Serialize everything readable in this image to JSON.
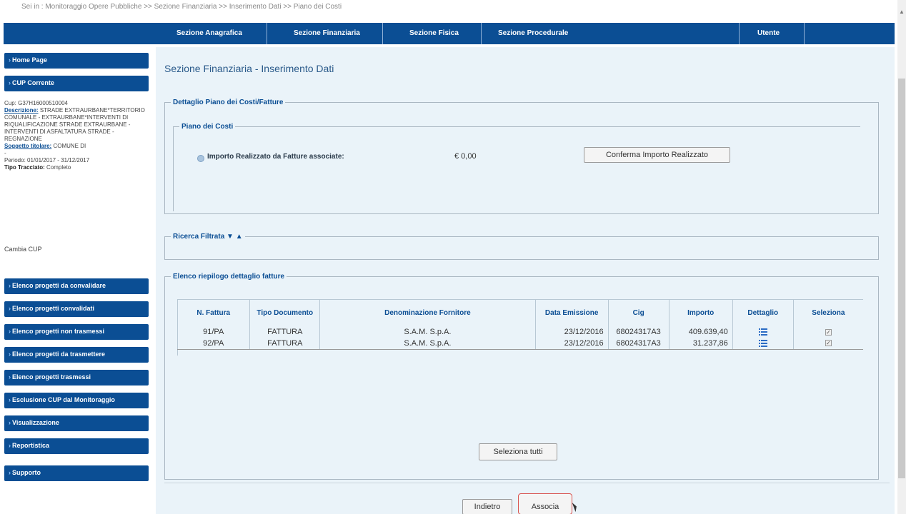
{
  "breadcrumb": "Sei in : Monitoraggio Opere Pubbliche >> Sezione Finanziaria >> Inserimento Dati >> Piano dei Costi",
  "topnav": {
    "items": [
      "Sezione Anagrafica",
      "Sezione Finanziaria",
      "Sezione Fisica",
      "Sezione Procedurale"
    ],
    "user": "Utente"
  },
  "sidebar": {
    "home": "Home Page",
    "cup_corrente": "CUP Corrente",
    "cup_info": {
      "cup_line": "Cup: G37H16000510004",
      "descrizione_label": "Descrizione:",
      "descrizione_value": "STRADE EXTRAURBANE*TERRITORIO COMUNALE - EXTRAURBANE*INTERVENTI DI RIQUALIFICAZIONE STRADE EXTRAURBANE - INTERVENTI DI ASFALTATURA STRADE - REGNAZIONE",
      "soggetto_label": "Soggetto titolare:",
      "soggetto_value": "COMUNE DI",
      "dash": "-",
      "periodo": "Periodo: 01/01/2017 - 31/12/2017",
      "tipo_label": "Tipo Tracciato:",
      "tipo_value": "Completo"
    },
    "cambia_cup": "Cambia CUP",
    "menu": [
      "Elenco progetti da convalidare",
      "Elenco progetti convalidati",
      "Elenco progetti non trasmessi",
      "Elenco progetti da trasmettere",
      "Elenco progetti trasmessi",
      "Esclusione CUP dal Monitoraggio",
      "Visualizzazione",
      "Reportistica",
      "Supporto"
    ]
  },
  "page": {
    "title": "Sezione Finanziaria - Inserimento Dati",
    "dettaglio_legend": "Dettaglio Piano dei Costi/Fatture",
    "piano_legend": "Piano dei Costi",
    "importo_label": "Importo Realizzato da Fatture associate:",
    "importo_value": "€ 0,00",
    "conferma_button": "Conferma Importo Realizzato",
    "ricerca_legend": "Ricerca Filtrata ▼ ▲",
    "elenco_legend": "Elenco riepilogo dettaglio fatture",
    "table": {
      "headers": [
        "N. Fattura",
        "Tipo Documento",
        "Denominazione Fornitore",
        "Data Emissione",
        "Cig",
        "Importo",
        "Dettaglio",
        "Seleziona"
      ],
      "rows": [
        [
          "91/PA",
          "FATTURA",
          "S.A.M. S.p.A.",
          "23/12/2016",
          "68024317A3",
          "409.639,40"
        ],
        [
          "92/PA",
          "FATTURA",
          "S.A.M. S.p.A.",
          "23/12/2016",
          "68024317A3",
          "31.237,86"
        ]
      ]
    },
    "seleziona_tutti": "Seleziona tutti",
    "indietro": "Indietro",
    "associa": "Associa"
  },
  "colors": {
    "nav_blue": "#0b4e94",
    "panel_bg": "#eaf3f9",
    "associa_border": "#d9534f"
  },
  "icons": {
    "dettaglio": "list-icon",
    "seleziona": "checkbox-icon"
  }
}
